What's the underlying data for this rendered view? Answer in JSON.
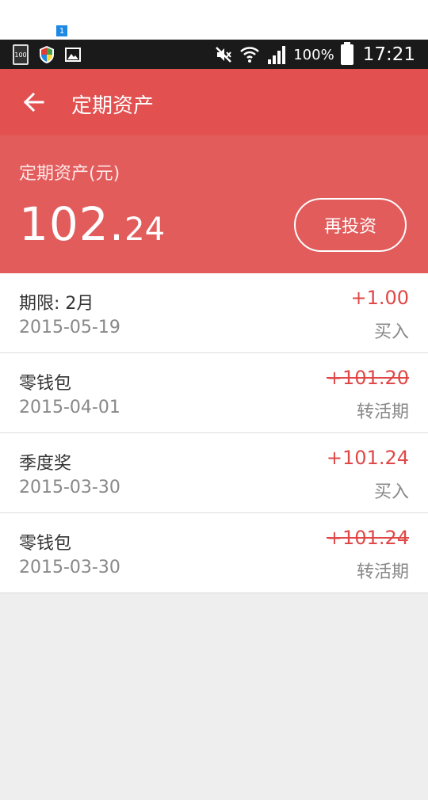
{
  "status_bar": {
    "battery_small_label": "100",
    "notification_badge": "1",
    "battery_percent": "100%",
    "time": "17:21"
  },
  "appbar": {
    "title": "定期资产"
  },
  "summary": {
    "label": "定期资产(元)",
    "amount_integer": "102.",
    "amount_fraction": "24",
    "reinvest_label": "再投资"
  },
  "transactions": [
    {
      "title": "期限: 2月",
      "date": "2015-05-19",
      "amount": "+1.00",
      "type": "买入",
      "strikethrough": false
    },
    {
      "title": "零钱包",
      "date": "2015-04-01",
      "amount": "+101.20",
      "type": "转活期",
      "strikethrough": true
    },
    {
      "title": "季度奖",
      "date": "2015-03-30",
      "amount": "+101.24",
      "type": "买入",
      "strikethrough": false
    },
    {
      "title": "零钱包",
      "date": "2015-03-30",
      "amount": "+101.24",
      "type": "转活期",
      "strikethrough": true
    }
  ],
  "colors": {
    "appbar": "#e25050",
    "summary": "#e25c5c",
    "amount_red": "#e04848"
  }
}
